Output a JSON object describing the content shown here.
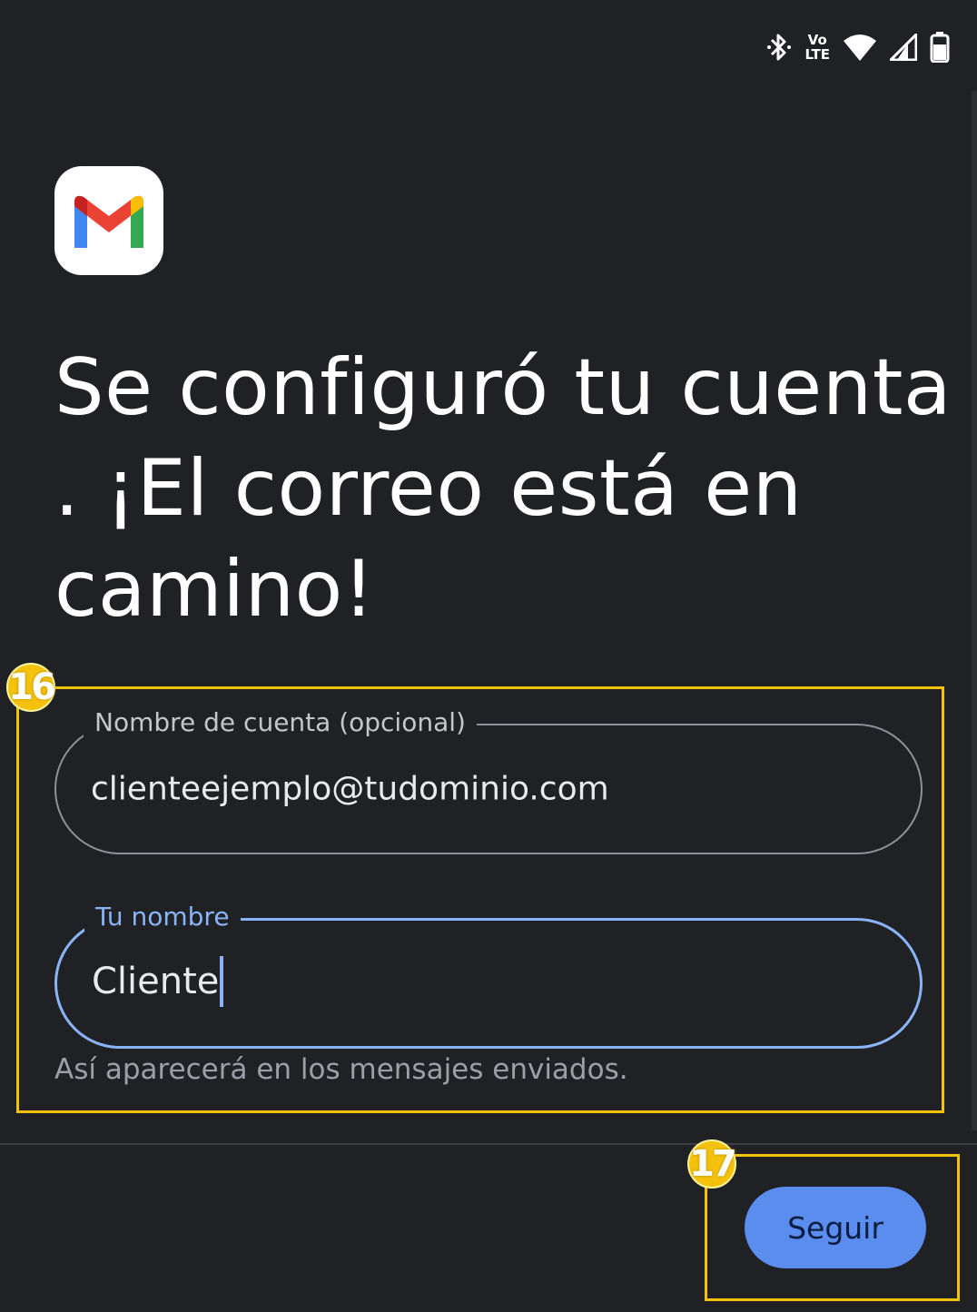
{
  "status_bar": {
    "icons": [
      "bluetooth-icon",
      "volte-icon",
      "wifi-icon",
      "cell-signal-icon",
      "battery-icon"
    ],
    "volte_top": "Vo",
    "volte_bottom": "LTE"
  },
  "app": {
    "logo": "gmail-logo",
    "brand_colors": [
      "#4285f4",
      "#ea4335",
      "#fbbc04",
      "#34a853"
    ]
  },
  "title": "Se configuró tu cuenta . ¡El correo está en camino!",
  "form": {
    "account_name": {
      "label": "Nombre de cuenta (opcional)",
      "value": "clienteejemplo@tudominio.com"
    },
    "your_name": {
      "label": "Tu nombre",
      "value": "Cliente",
      "helper": "Así aparecerá en los mensajes enviados.",
      "focused": true
    }
  },
  "actions": {
    "next_label": "Seguir"
  },
  "annotations": [
    {
      "number": "16",
      "color": "#f4c20d"
    },
    {
      "number": "17",
      "color": "#f4c20d"
    }
  ],
  "colors": {
    "background": "#202124",
    "accent": "#8ab4f8",
    "button": "#5b8def",
    "annotation": "#f4c20d"
  }
}
